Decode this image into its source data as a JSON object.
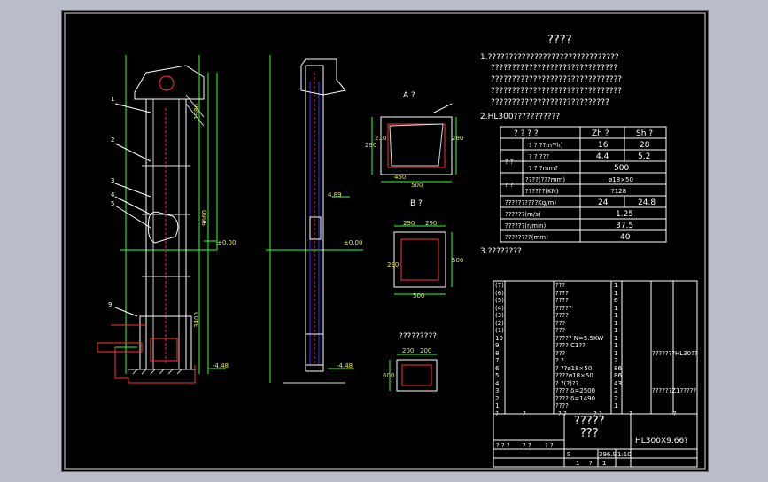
{
  "title": "????",
  "notes": [
    "1.???????????????????????????????",
    "??????????????????????????????",
    "???????????????????????????????",
    "???????????????????????????????",
    "????????????????????????????"
  ],
  "section2": "2.HL300???????????",
  "section3": "3.????????",
  "view_a": "A ?",
  "view_b": "B ?",
  "foundation": "?????????",
  "level_000": "±0.00",
  "level_448": "-4.48",
  "level_489": "4.89",
  "view_a_dims": [
    "450",
    "500",
    "290",
    "210",
    "280"
  ],
  "view_b_dims": [
    "290",
    "290",
    "290",
    "500",
    "500"
  ],
  "foundation_dims": [
    "200",
    "200",
    "600"
  ],
  "spec_table": {
    "header": [
      "? ? ? ?",
      "Zh ?",
      "Sh ?"
    ],
    "rows": [
      {
        "group": "",
        "label": "? ? ??m³/h)",
        "v1": "16",
        "v2": "28"
      },
      {
        "group": "? ?",
        "label": "? ? ???",
        "v1": "4.4",
        "v2": "5.2"
      },
      {
        "group": "",
        "label": "? ? ?mm?",
        "v": "500"
      },
      {
        "group": "? ?",
        "label": "????(???mm)",
        "v": "ø18×50"
      },
      {
        "group": "",
        "label": "??????(KN)",
        "v": "?128"
      },
      {
        "group": "",
        "label": "??????????Kg/m)",
        "v1": "24",
        "v2": "24.8"
      },
      {
        "group": "",
        "label": "??????(m/s)",
        "v": "1.25"
      },
      {
        "group": "",
        "label": "??????(r/min)",
        "v": "37.5"
      },
      {
        "group": "",
        "label": "????????(mm)",
        "v": "40"
      }
    ]
  },
  "parts": [
    {
      "no": "(7)",
      "name": "???",
      "qty": "1"
    },
    {
      "no": "(6)",
      "name": "????",
      "qty": "1"
    },
    {
      "no": "(5)",
      "name": "????",
      "qty": "6"
    },
    {
      "no": "(4)",
      "name": "?????",
      "qty": "1"
    },
    {
      "no": "(3)",
      "name": "????",
      "qty": "1"
    },
    {
      "no": "(2)",
      "name": "???",
      "qty": "1"
    },
    {
      "no": "(1)",
      "name": "???",
      "qty": "1"
    },
    {
      "no": "10",
      "name": "????? N=5.5KW",
      "qty": "1"
    },
    {
      "no": "9",
      "name": "???? C1??",
      "qty": "1"
    },
    {
      "no": "8",
      "name": "???",
      "qty": "1",
      "note": "???????HL30??"
    },
    {
      "no": "7",
      "name": "? ?",
      "qty": "2"
    },
    {
      "no": "6",
      "name": "? ??ø18×50",
      "qty": "86"
    },
    {
      "no": "5",
      "name": "????ø18×50",
      "qty": "86"
    },
    {
      "no": "4",
      "name": "? ?(?)??",
      "qty": "43"
    },
    {
      "no": "3",
      "name": "???? δ=2500",
      "qty": "2",
      "note": "??????Z1?????"
    },
    {
      "no": "2",
      "name": "???? δ=1490",
      "qty": "2"
    },
    {
      "no": "1",
      "name": "????",
      "qty": "1"
    }
  ],
  "parts_header": [
    "?",
    "?",
    "? ?",
    "? ?",
    "?",
    "?"
  ],
  "title_block": {
    "name": "?????\n???",
    "code": "HL300X9.66?",
    "scale": "396.9",
    "sheet": "1:10",
    "small": [
      "? ? ?",
      "? ?",
      "? ?",
      "S",
      "1",
      "?",
      "1"
    ]
  },
  "elevator_labels": [
    "1",
    "2",
    "3",
    "4",
    "5",
    "9"
  ],
  "elevator_dims": [
    "9660",
    "1980",
    "3400"
  ]
}
